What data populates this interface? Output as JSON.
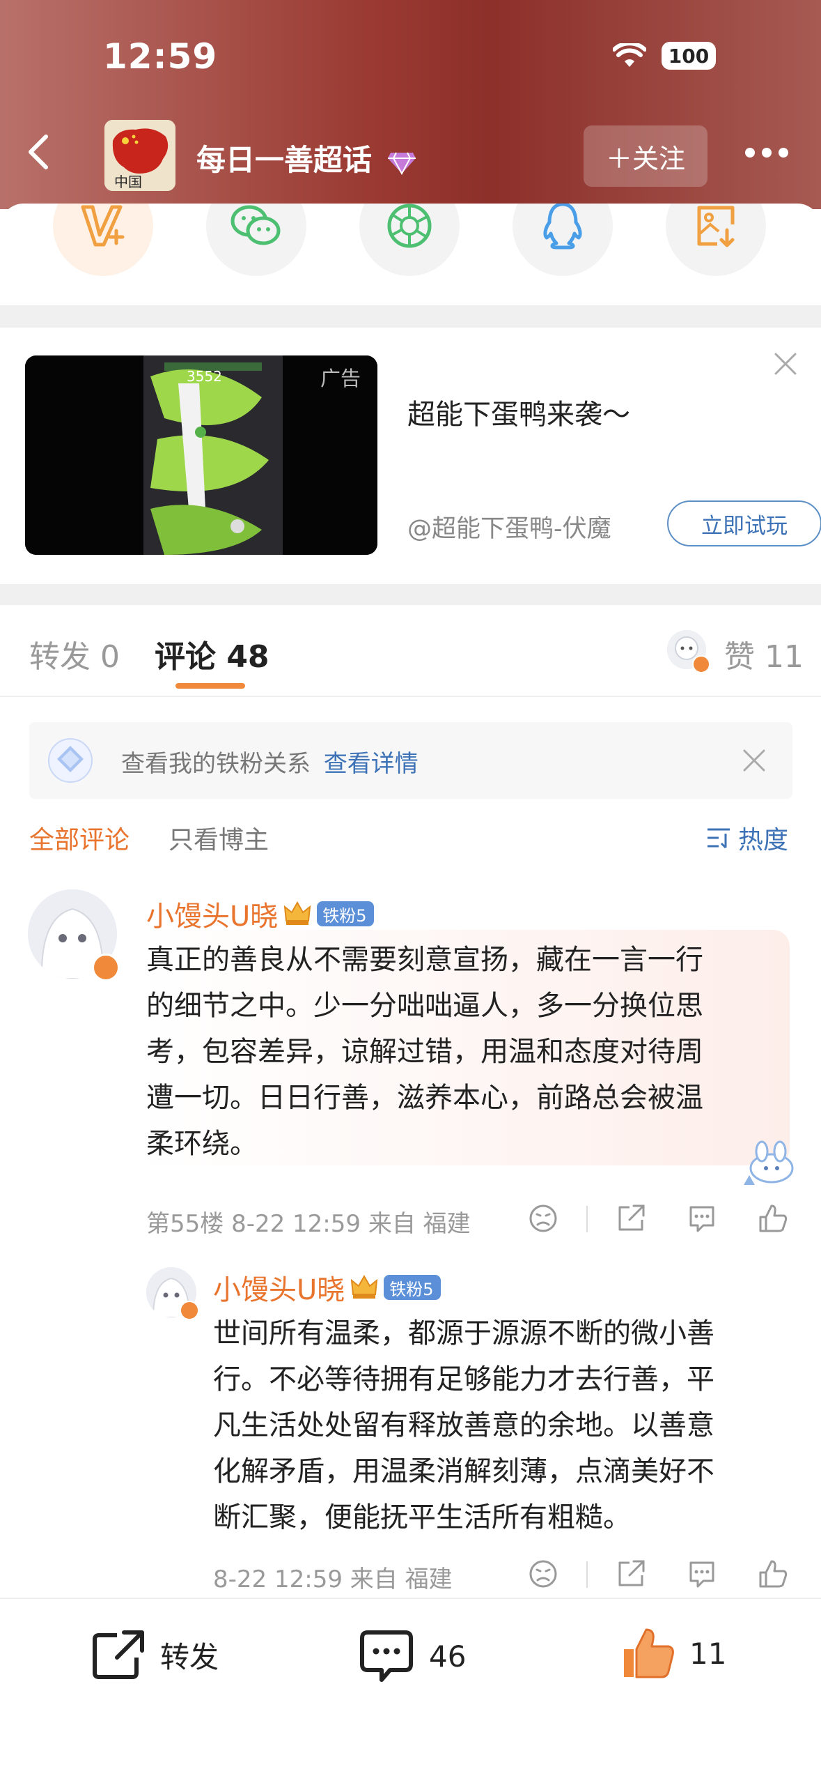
{
  "status_bar": {
    "time": "12:59",
    "battery": "100"
  },
  "header": {
    "title": "每日一善超话",
    "follow_label": "＋关注"
  },
  "ad": {
    "tag": "广告",
    "game_score": "3552",
    "title": "超能下蛋鸭来袭～",
    "source": "@超能下蛋鸭-伏魔",
    "button_label": "立即试玩"
  },
  "tabs": {
    "repost": "转发 0",
    "comment": "评论 48",
    "like": "赞 11"
  },
  "fans_banner": {
    "text": "查看我的铁粉关系",
    "link": "查看详情"
  },
  "filter": {
    "all": "全部评论",
    "author_only": "只看博主",
    "sort": "热度"
  },
  "comments": [
    {
      "username": "小馒头U晓",
      "badge": "铁粉5",
      "text": [
        "真正的善良从不需要刻意宣扬，藏在一言一行",
        "的细节之中。少一分咄咄逼人，多一分换位思",
        "考，包容差异，谅解过错，用温和态度对待周",
        "遭一切。日日行善，滋养本心，前路总会被温",
        "柔环绕。"
      ],
      "meta": "第55楼  8-22 12:59  来自 福建"
    },
    {
      "username": "小馒头U晓",
      "badge": "铁粉5",
      "text": [
        "世间所有温柔，都源于源源不断的微小善",
        "行。不必等待拥有足够能力才去行善，平",
        "凡生活处处留有释放善意的余地。以善意",
        "化解矛盾，用温柔消解刻薄，点滴美好不",
        "断汇聚，便能抚平生活所有粗糙。"
      ],
      "meta": "8-22 12:59  来自 福建"
    }
  ],
  "bottom_bar": {
    "repost_label": "转发",
    "comment_count": "46",
    "like_count": "11"
  },
  "colors": {
    "accent_orange": "#e8742e",
    "link_blue": "#3d73b6",
    "header_red": "#8d2f2a"
  }
}
